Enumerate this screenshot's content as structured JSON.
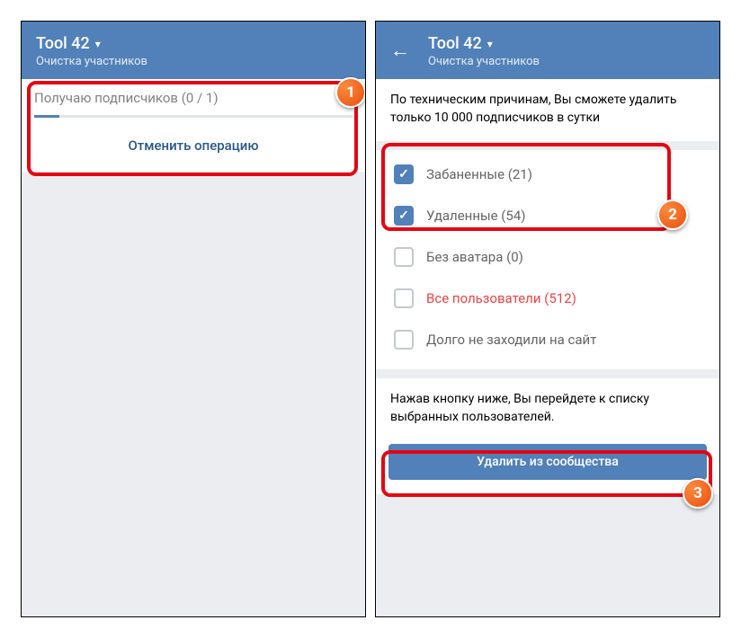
{
  "left": {
    "title": "Tool 42",
    "subtitle": "Очистка участников",
    "loading": "Получаю подписчиков (0 / 1)",
    "cancel": "Отменить операцию"
  },
  "right": {
    "title": "Tool 42",
    "subtitle": "Очистка участников",
    "info": "По техническим причинам, Вы сможете удалить только 10 000 подписчиков в сутки",
    "options": {
      "banned": "Забаненные (21)",
      "deleted": "Удаленные (54)",
      "noavatar": "Без аватара (0)",
      "all": "Все пользователи (512)",
      "inactive": "Долго не заходили на сайт"
    },
    "hint": "Нажав кнопку ниже, Вы перейдете к списку выбранных пользователей.",
    "deleteBtn": "Удалить из сообщества"
  },
  "badges": {
    "b1": "1",
    "b2": "2",
    "b3": "3"
  }
}
